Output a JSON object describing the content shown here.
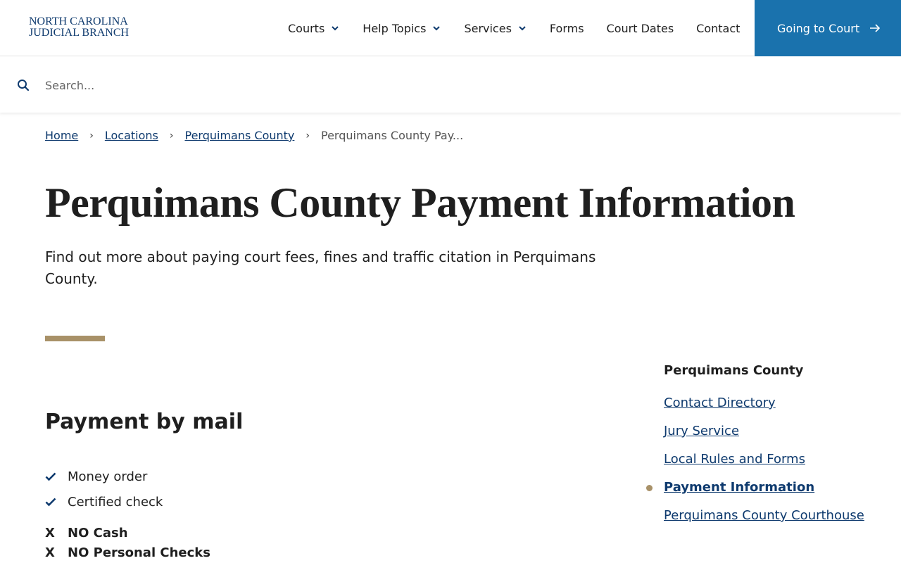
{
  "header": {
    "logo_line1": "NORTH CAROLINA",
    "logo_line2": "JUDICIAL BRANCH",
    "nav": [
      {
        "label": "Courts",
        "has_dropdown": true
      },
      {
        "label": "Help Topics",
        "has_dropdown": true
      },
      {
        "label": "Services",
        "has_dropdown": true
      },
      {
        "label": "Forms",
        "has_dropdown": false
      },
      {
        "label": "Court Dates",
        "has_dropdown": false
      },
      {
        "label": "Contact",
        "has_dropdown": false
      }
    ],
    "cta_label": "Going to Court"
  },
  "search": {
    "placeholder": "Search...",
    "value": ""
  },
  "breadcrumb": {
    "items": [
      "Home",
      "Locations",
      "Perquimans County"
    ],
    "current": "Perquimans County Pay..."
  },
  "page": {
    "title": "Perquimans County Payment Information",
    "lede": "Find out more about paying court fees, fines and traffic citation in Perquimans County."
  },
  "content": {
    "heading": "Payment by mail",
    "accepted": [
      "Money order",
      "Certified check"
    ],
    "not_accepted": [
      "NO Cash",
      "NO Personal Checks"
    ],
    "not_accepted_marker": "X"
  },
  "sidebar": {
    "title": "Perquimans County",
    "items": [
      {
        "label": "Contact Directory",
        "active": false
      },
      {
        "label": "Jury Service",
        "active": false
      },
      {
        "label": "Local Rules and Forms",
        "active": false
      },
      {
        "label": "Payment Information",
        "active": true
      },
      {
        "label": "Perquimans County Courthouse",
        "active": false
      }
    ]
  },
  "colors": {
    "brand_navy": "#0e3a6e",
    "cta_blue": "#1a72ad",
    "accent_gold": "#a89168"
  },
  "icons": {
    "search": "search-icon",
    "dropdown": "chevron-down-icon",
    "cta": "arrow-right-icon",
    "accepted": "check-icon"
  }
}
